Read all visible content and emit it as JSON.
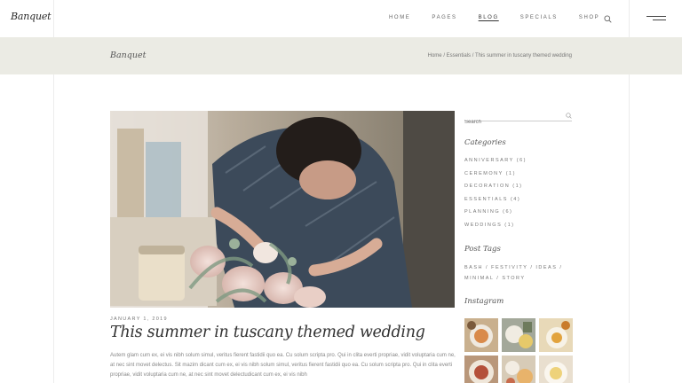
{
  "header": {
    "logo": "Banquet",
    "nav": [
      "Home",
      "Pages",
      "Blog",
      "Specials",
      "Shop"
    ],
    "active_nav": "Blog",
    "icons": [
      "search-icon",
      "menu-icon"
    ]
  },
  "titlebar": {
    "title": "Banquet",
    "breadcrumb": {
      "home": "Home",
      "sep1": " / ",
      "category": "Essentials",
      "sep2": " / ",
      "current": "This summer in tuscany themed wedding"
    }
  },
  "post": {
    "date": "January 1, 2019",
    "title": "This summer in tuscany themed wedding",
    "excerpt": "Autem glam cum ex, ei vis nibh solum simul, veritus fierent fastidii quo ea. Cu solum scripta pro. Qui in clita everti propriae, vidit voluptaria cum ne, at nec sint movet delectus. Sit mazim dicant cum ex, ei vis nibh solum simul, veritus fierent fastidii quo ea. Cu solum scripta pro. Qui in clita everti propriae, vidit voluptaria cum ne, at nec sint movet delectudicant cum ex, ei vis nibh"
  },
  "sidebar": {
    "search_placeholder": "Search",
    "categories_heading": "Categories",
    "categories": [
      "Anniversary (6)",
      "Ceremony (1)",
      "Decoration (1)",
      "Essentials (4)",
      "Planning (6)",
      "Weddings (1)"
    ],
    "tags_heading": "Post Tags",
    "tags": [
      "Bash",
      "Festivity",
      "Ideas",
      "Minimal",
      "Story"
    ],
    "tag_separator": " / ",
    "instagram_heading": "Instagram",
    "instagram_count": 6
  },
  "colors": {
    "titlebar_bg": "#ebebe4",
    "text_dark": "#333333",
    "text_muted": "#777777"
  }
}
